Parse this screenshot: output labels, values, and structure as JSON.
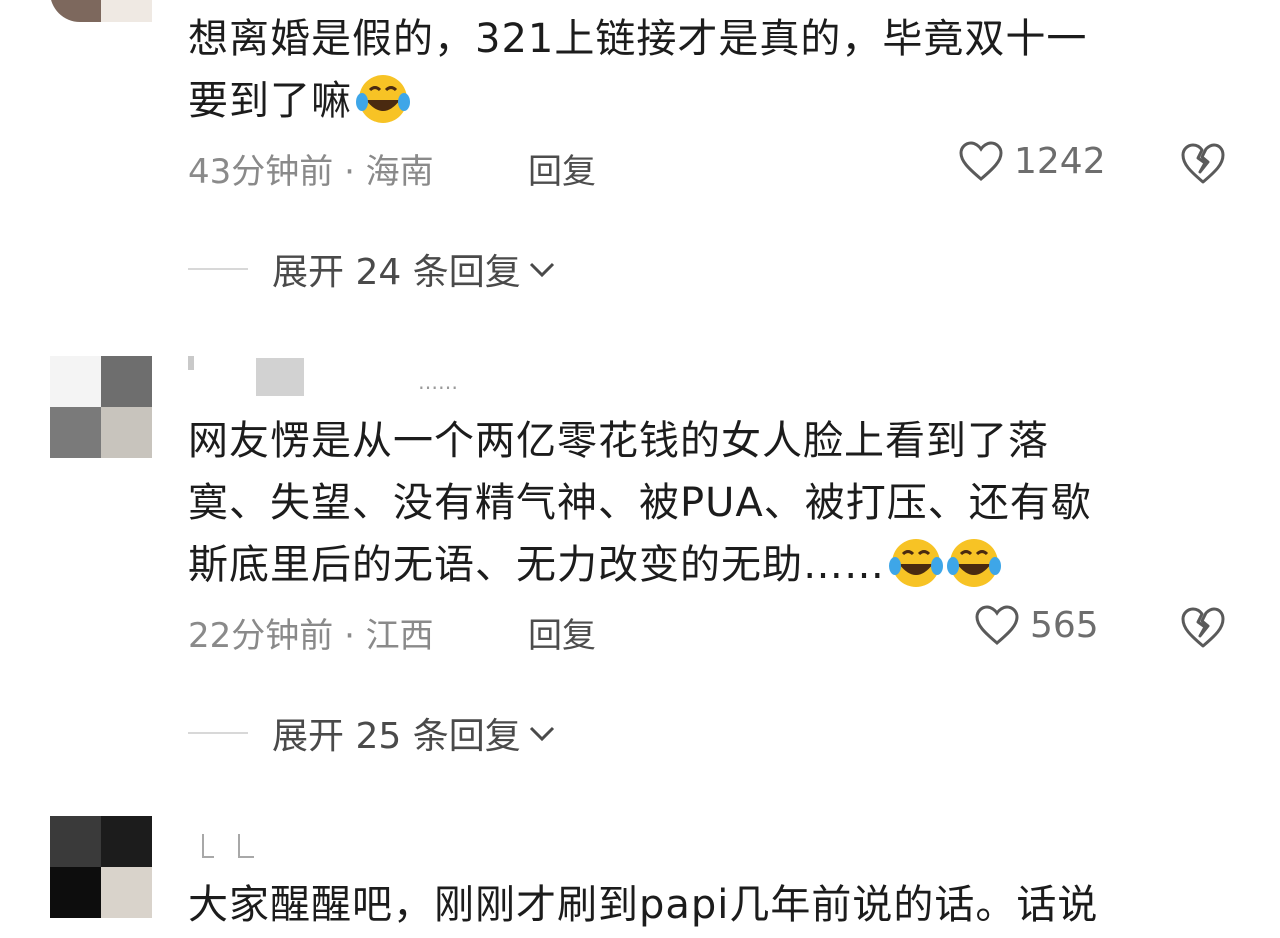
{
  "comments": [
    {
      "username": "",
      "text_lines": [
        "想离婚是假的，321上链接才是真的，毕竟双十一",
        "要到了嘛"
      ],
      "emoji_count": 1,
      "time_location": "43分钟前 · 海南",
      "reply_label": "回复",
      "likes": "1242",
      "expand_label": "展开 24 条回复",
      "avatar_colors": [
        "#8a7468",
        "#b8a89c",
        "#cfc3b8",
        "#efe9e3"
      ]
    },
    {
      "username": "",
      "subtext": "……",
      "text_lines": [
        "网友愣是从一个两亿零花钱的女人脸上看到了落",
        "寞、失望、没有精气神、被PUA、被打压、还有歇",
        "斯底里后的无语、无力改变的无助……"
      ],
      "emoji_count": 2,
      "time_location": "22分钟前 · 江西",
      "reply_label": "回复",
      "likes": "565",
      "expand_label": "展开 25 条回复",
      "avatar_colors": [
        "#f4f4f4",
        "#6e6e6e",
        "#7a7a7a",
        "#c8c4bd"
      ]
    },
    {
      "username": "",
      "text_lines": [
        "大家醒醒吧，刚刚才刷到papi几年前说的话。话说"
      ],
      "emoji_count": 0,
      "avatar_colors": [
        "#3a3a3a",
        "#1c1c1c",
        "#0d0d0d",
        "#d9d3cb"
      ]
    }
  ],
  "icons": {
    "like": "heart-outline-icon",
    "dislike": "broken-heart-icon",
    "expand": "chevron-down-icon",
    "emoji": "laughing-tears-emoji-icon"
  },
  "colors": {
    "text": "#1c1c1c",
    "meta": "#8a8a8a",
    "reply": "#4d4d4d",
    "divider": "#d8d8d8",
    "emoji_face": "#f7c325"
  }
}
